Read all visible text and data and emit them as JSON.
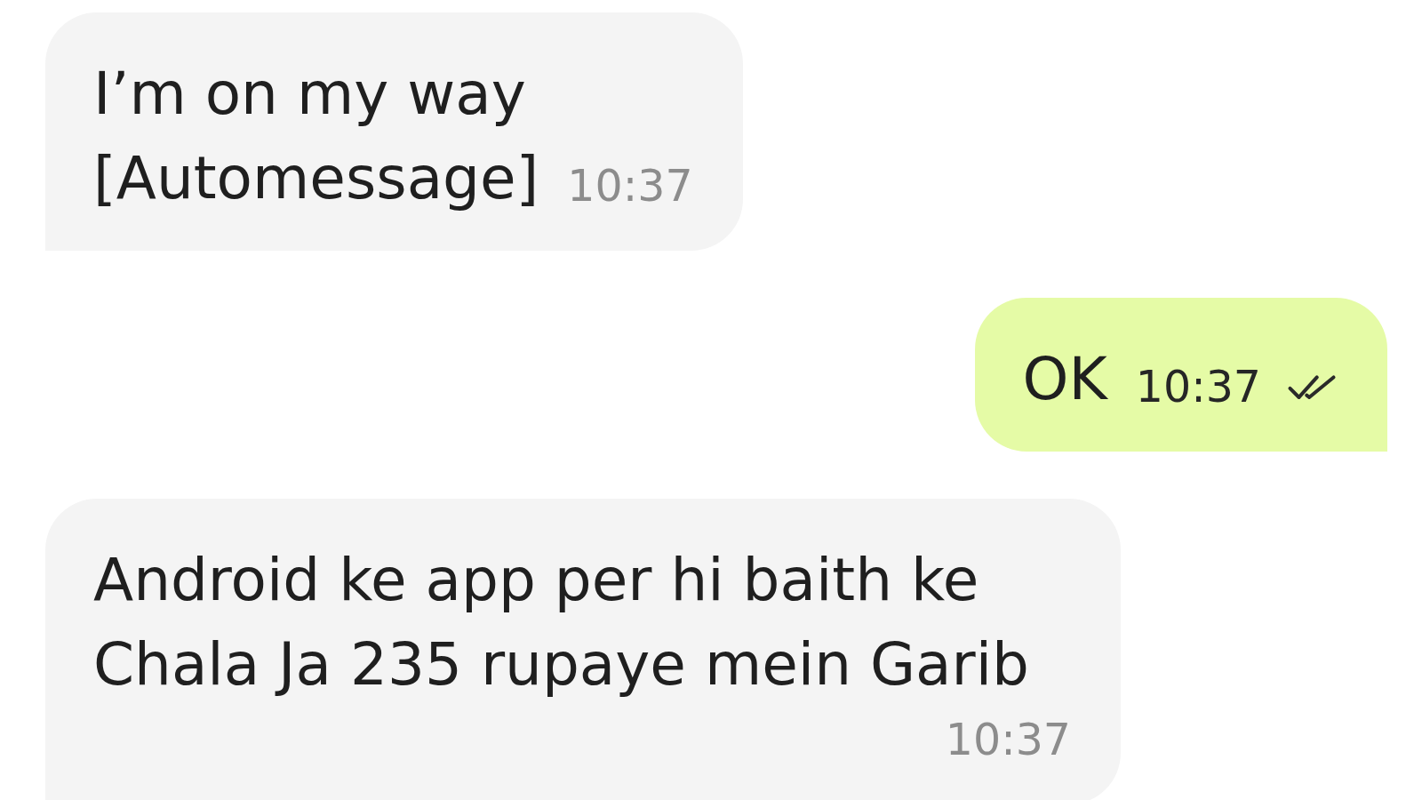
{
  "messages": [
    {
      "kind": "incoming",
      "text": "I’m on my way\n[Automessage]",
      "time": "10:37"
    },
    {
      "kind": "outgoing",
      "text": "OK",
      "time": "10:37",
      "delivered": true
    },
    {
      "kind": "incoming",
      "text": "Android ke app per hi baith ke Chala Ja 235 rupaye mein Garib",
      "time": "10:37"
    }
  ]
}
